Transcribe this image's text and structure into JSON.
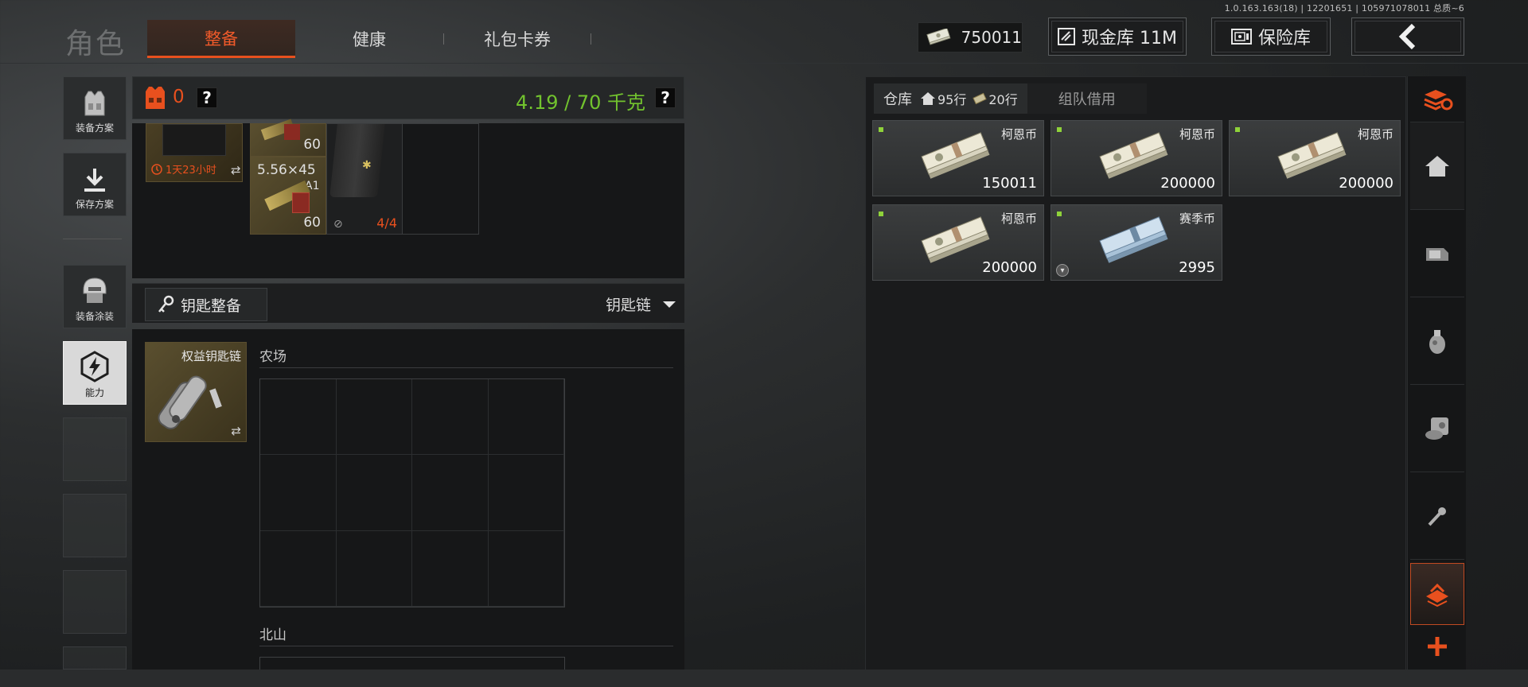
{
  "version": "1.0.163.163(18) | 12201651 | 105971078011 总质~6",
  "header": {
    "title": "角色",
    "tabs": [
      {
        "label": "整备",
        "active": true
      },
      {
        "label": "健康",
        "active": false
      },
      {
        "label": "礼包卡券",
        "active": false
      }
    ],
    "cash": "750011",
    "cash_vault_label": "现金库 11M",
    "safe_label": "保险库"
  },
  "sidebar": {
    "items": [
      {
        "label": "装备方案",
        "icon": "vest-icon"
      },
      {
        "label": "保存方案",
        "icon": "download-icon"
      },
      {
        "label": "装备涂装",
        "icon": "helmet-icon"
      },
      {
        "label": "能力",
        "icon": "lightning-icon",
        "active": true
      }
    ]
  },
  "loadout": {
    "armor_count": "0",
    "weight": "4.19 / 70 千克",
    "timer": "1天23小时",
    "ammo_top_count": "60",
    "ammo_name": "5.56×45",
    "ammo_sub": "A1",
    "ammo_count": "60",
    "mag_count": "4/4"
  },
  "keys": {
    "title": "钥匙整备",
    "dropdown": "钥匙链",
    "keychain_name": "权益钥匙链",
    "sections": [
      "农场",
      "北山"
    ]
  },
  "warehouse": {
    "tab_label": "仓库",
    "rows_home": "95行",
    "rows_cash": "20行",
    "team_tab": "组队借用",
    "items": [
      {
        "name": "柯恩币",
        "value": "150011",
        "type": "koen"
      },
      {
        "name": "柯恩币",
        "value": "200000",
        "type": "koen"
      },
      {
        "name": "柯恩币",
        "value": "200000",
        "type": "koen"
      },
      {
        "name": "柯恩币",
        "value": "200000",
        "type": "koen"
      },
      {
        "name": "赛季币",
        "value": "2995",
        "type": "season"
      }
    ]
  },
  "colors": {
    "accent": "#e8501e",
    "weight": "#72c32e",
    "marker": "#8fd23a"
  }
}
